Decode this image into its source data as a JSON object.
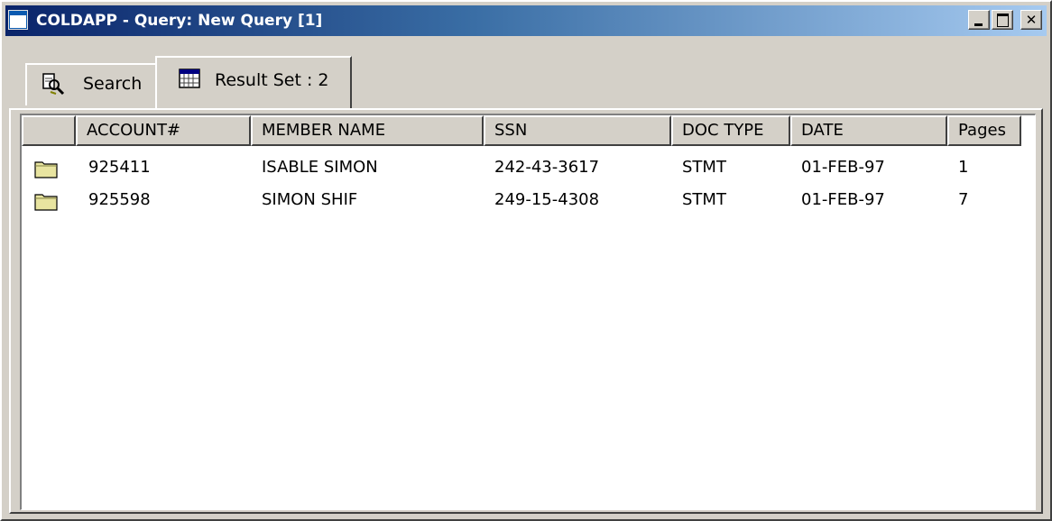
{
  "window": {
    "title": "COLDAPP - Query: New Query [1]",
    "icon": "window-icon",
    "controls": {
      "minimize": "minimize-icon",
      "maximize": "maximize-icon",
      "close_label": "✕"
    }
  },
  "tabs": [
    {
      "label": "Search",
      "icon": "search-icon",
      "active": false
    },
    {
      "label": "Result Set : 2",
      "icon": "table-icon",
      "active": true
    }
  ],
  "table": {
    "columns": [
      "",
      "ACCOUNT#",
      "MEMBER NAME",
      "SSN",
      "DOC TYPE",
      "DATE",
      "Pages"
    ],
    "rows": [
      {
        "icon": "folder-icon",
        "account": "925411",
        "member_name": "ISABLE SIMON",
        "ssn": "242-43-3617",
        "doc_type": "STMT",
        "date": "01-FEB-97",
        "pages": "1"
      },
      {
        "icon": "folder-icon",
        "account": "925598",
        "member_name": "SIMON SHIF",
        "ssn": "249-15-4308",
        "doc_type": "STMT",
        "date": "01-FEB-97",
        "pages": "7"
      }
    ]
  },
  "colors": {
    "title_gradient_start": "#0a246a",
    "title_gradient_end": "#a6caf0",
    "face": "#d4d0c8",
    "list_background": "#ffffff",
    "folder": "#e8e4a0"
  }
}
